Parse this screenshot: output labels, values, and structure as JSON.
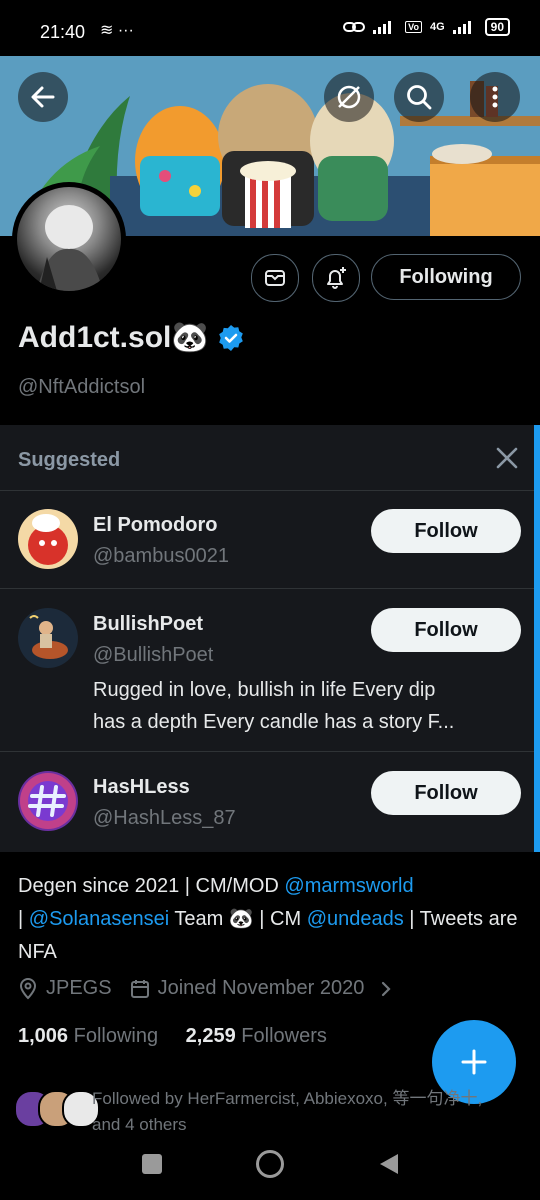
{
  "status_bar": {
    "time": "21:40",
    "left_icons": "≋ ···",
    "network": "4G",
    "battery": "90"
  },
  "profile": {
    "name": "Add1ct.sol🐼",
    "handle": "@NftAddictsol",
    "following_label": "Following",
    "bio_parts": {
      "p1": "Degen since 2021 | CM/MOD ",
      "l1": "@marmsworld",
      "p2": "| ",
      "l2": "@Solanasensei",
      "p3": " Team 🐼 | CM ",
      "l3": "@undeads",
      "p4": " | Tweets are NFA"
    },
    "location": "JPEGS",
    "joined": "Joined November 2020",
    "following_count": "1,006",
    "following_text": "Following",
    "followers_count": "2,259",
    "followers_text": "Followers",
    "followed_by": "Followed by HerFarmercist, Abbiexoxo, 等一句净十, and 4 others"
  },
  "suggested": {
    "title": "Suggested",
    "accounts": [
      {
        "name": "El Pomodoro",
        "handle": "@bambus0021",
        "button": "Follow"
      },
      {
        "name": "BullishPoet",
        "handle": "@BullishPoet",
        "bio_line1": "Rugged in love, bullish in life Every dip",
        "bio_line2": "has a depth  Every candle has a story F...",
        "button": "Follow"
      },
      {
        "name": "HasHLess",
        "handle": "@HashLess_87",
        "button": "Follow"
      }
    ]
  },
  "colors": {
    "accent": "#1d9bf0",
    "background": "#000000",
    "panel": "#16181c"
  },
  "icons": [
    "back-arrow-icon",
    "hide-icon",
    "search-icon",
    "more-vertical-icon",
    "mail-icon",
    "bell-plus-icon",
    "verified-badge-icon",
    "close-icon",
    "location-icon",
    "calendar-icon",
    "chevron-right-icon",
    "plus-icon"
  ]
}
